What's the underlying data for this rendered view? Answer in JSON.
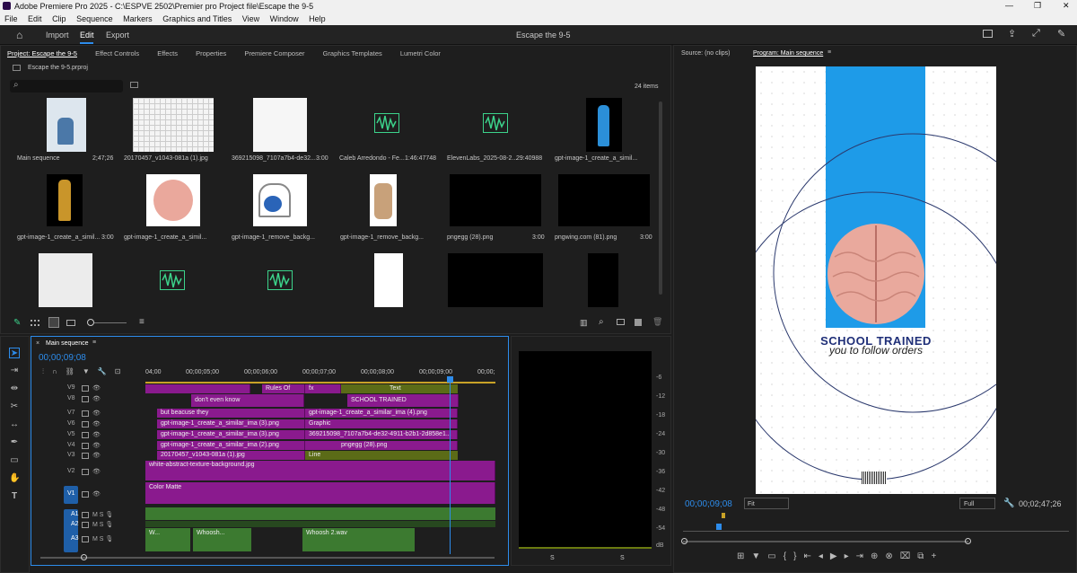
{
  "window": {
    "title": "Adobe Premiere Pro 2025 - C:\\ESPVE 2502\\Premier pro Project file\\Escape the 9-5",
    "controls": [
      "—",
      "❐",
      "✕"
    ]
  },
  "menu": [
    "File",
    "Edit",
    "Clip",
    "Sequence",
    "Markers",
    "Graphics and Titles",
    "View",
    "Window",
    "Help"
  ],
  "workspace": {
    "tabs": [
      "Import",
      "Edit",
      "Export"
    ],
    "active_tab": "Edit",
    "project_name": "Escape the 9-5"
  },
  "project_panel": {
    "tabs": [
      "Project: Escape the 9-5",
      "Effect Controls",
      "Effects",
      "Properties",
      "Premiere Composer",
      "Graphics Templates",
      "Lumetri Color"
    ],
    "file": "Escape the 9-5.prproj",
    "item_count": "24 items",
    "items": [
      {
        "name": "Main sequence",
        "duration": "2;47;26"
      },
      {
        "name": "20170457_v1043-081a (1).jpg",
        "duration": "3:00"
      },
      {
        "name": "369215098_7107a7b4-de32...",
        "duration": "3:00"
      },
      {
        "name": "Caleb Arredondo - Fe...",
        "duration": "1:46:47748"
      },
      {
        "name": "ElevenLabs_2025-08-2...",
        "duration": "29:40988"
      },
      {
        "name": "gpt-image-1_create_a_simil...",
        "duration": "3:00"
      },
      {
        "name": "gpt-image-1_create_a_simil...",
        "duration": "3:00"
      },
      {
        "name": "gpt-image-1_create_a_simil...",
        "duration": "3:00"
      },
      {
        "name": "gpt-image-1_remove_backg...",
        "duration": "3:00"
      },
      {
        "name": "gpt-image-1_remove_backg...",
        "duration": "3:00"
      },
      {
        "name": "pngegg (28).png",
        "duration": "3:00"
      },
      {
        "name": "pngwing.com (81).png",
        "duration": "3:00"
      }
    ]
  },
  "source_panel": {
    "tab": "Source: (no clips)"
  },
  "program_panel": {
    "tab": "Program: Main sequence",
    "headline": "SCHOOL TRAINED",
    "subline": "you to follow orders",
    "timecode": "00;00;09;08",
    "fit": "Fit",
    "quality": "Full",
    "duration": "00;02;47;26"
  },
  "timeline": {
    "tab": "Main sequence",
    "timecode": "00;00;09;08",
    "ruler": [
      "04;00",
      "00;00;05;00",
      "00;00;06;00",
      "00;00;07;00",
      "00;00;08;00",
      "00;00;09;00",
      "00;00;"
    ],
    "tracks": [
      "V9",
      "V8",
      "V7",
      "V6",
      "V5",
      "V4",
      "V3",
      "V2",
      "V1",
      "A1",
      "A2",
      "A3"
    ],
    "clips": {
      "rules_of": "Rules Of",
      "text": "Text",
      "dont_even_know": "don't even know",
      "school_trained": "SCHOOL TRAINED",
      "but_because_they": "but beacuse they",
      "gpt4": "gpt-image-1_create_a_similar_ima (4).png",
      "gpt3a": "gpt-image-1_create_a_similar_ima (3).png",
      "graphic": "Graphic",
      "gpt3b": "gpt-image-1_create_a_similar_ima (3).png",
      "img369": "369215098_7107a7b4-de32-4911-b2b1-2d858e1...",
      "gpt2": "gpt-image-1_create_a_similar_ima (2).png",
      "pngegg": "pngegg (28).png",
      "img2017": "20170457_v1043-081a (1).jpg",
      "line": "Line",
      "white_bg": "white-abstract-texture-background.jpg",
      "color_matte": "Color Matte",
      "whoo1": "W...",
      "whoosh": "Whoosh...",
      "whoosh2": "Whoosh 2.wav",
      "fx": "fx"
    }
  },
  "meter": {
    "labels": [
      "-6",
      "-12",
      "-18",
      "-24",
      "-30",
      "-36",
      "-42",
      "-48",
      "-54",
      "dB"
    ],
    "bottom": [
      "S",
      "S"
    ]
  },
  "colors": {
    "accent": "#2d8ceb",
    "clip_purple": "#8a1a8e",
    "clip_olive": "#5b6b17",
    "audio_green": "#3c7a30",
    "program_blue": "#1e9be8",
    "headline": "#1f2f78"
  }
}
